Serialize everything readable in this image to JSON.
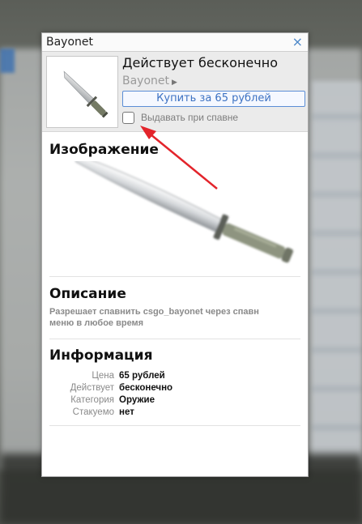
{
  "window": {
    "title": "Bayonet",
    "close_glyph": "×"
  },
  "item": {
    "status": "Действует бесконечно",
    "name": "Bayonet",
    "buy_label": "Купить за 65 рублей",
    "spawn_label": "Выдавать при спавне",
    "spawn_checked": false
  },
  "sections": {
    "image_title": "Изображение",
    "description_title": "Описание",
    "description_lines": [
      "Разрешает спавнить csgo_bayonet через спавн",
      "меню в любое время"
    ],
    "info_title": "Информация"
  },
  "info": [
    {
      "key": "Цена",
      "value": "65 рублей"
    },
    {
      "key": "Действует",
      "value": "бесконечно"
    },
    {
      "key": "Категория",
      "value": "Оружие"
    },
    {
      "key": "Стакуемо",
      "value": "нет"
    }
  ],
  "colors": {
    "accent": "#3d72c2",
    "annotation_arrow": "#e3242b"
  },
  "icons": {
    "close": "close-icon",
    "submenu": "triangle-right-icon",
    "thumbnail": "bayonet-knife-icon"
  }
}
